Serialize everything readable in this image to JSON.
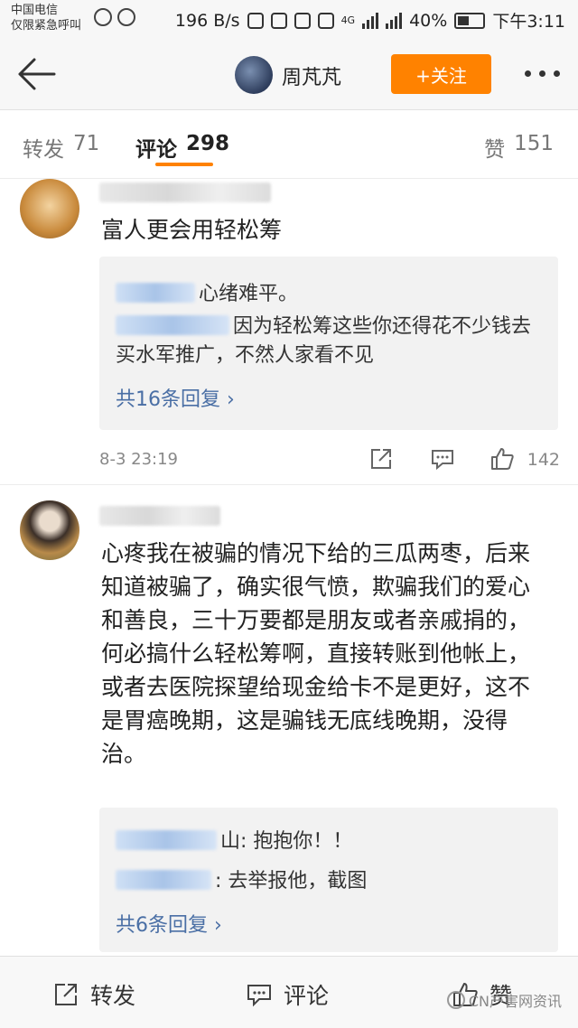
{
  "status_bar": {
    "carrier_line1": "中国电信",
    "carrier_line2": "仅限紧急呼叫",
    "speed": "196 B/s",
    "network": "4G",
    "battery": "40%",
    "time": "下午3:11"
  },
  "header": {
    "back_icon": "back-arrow-icon",
    "title": "周芃芃",
    "follow_label": "+关注",
    "more_icon": "more-dots-icon",
    "accent_color": "#ff8200"
  },
  "tabs": [
    {
      "label": "转发",
      "count": "71"
    },
    {
      "label": "评论",
      "count": "298"
    },
    {
      "label": "赞",
      "count": "151"
    }
  ],
  "comments": [
    {
      "text": "富人更会用轻松筹",
      "replies": [
        {
          "text": "心绪难平。"
        },
        {
          "text": "因为轻松筹这些你还得花不少钱去买水军推广，不然人家看不见"
        }
      ],
      "more_replies": "共16条回复 ›",
      "time": "8-3 23:19",
      "like_count": "142"
    },
    {
      "text": "心疼我在被骗的情况下给的三瓜两枣，后来知道被骗了，确实很气愤，欺骗我们的爱心和善良，三十万要都是朋友或者亲戚捐的，何必搞什么轻松筹啊，直接转账到他帐上，或者去医院探望给现金给卡不是更好，这不是胃癌晚期，这是骗钱无底线晚期，没得治。",
      "replies": [
        {
          "text": "山: 抱抱你！！"
        },
        {
          "text": ": 去举报他，截图"
        }
      ],
      "more_replies": "共6条回复 ›"
    }
  ],
  "bottom_bar": {
    "repost_label": "转发",
    "comment_label": "评论",
    "like_label": "赞"
  },
  "watermark": "CN产害网资讯"
}
